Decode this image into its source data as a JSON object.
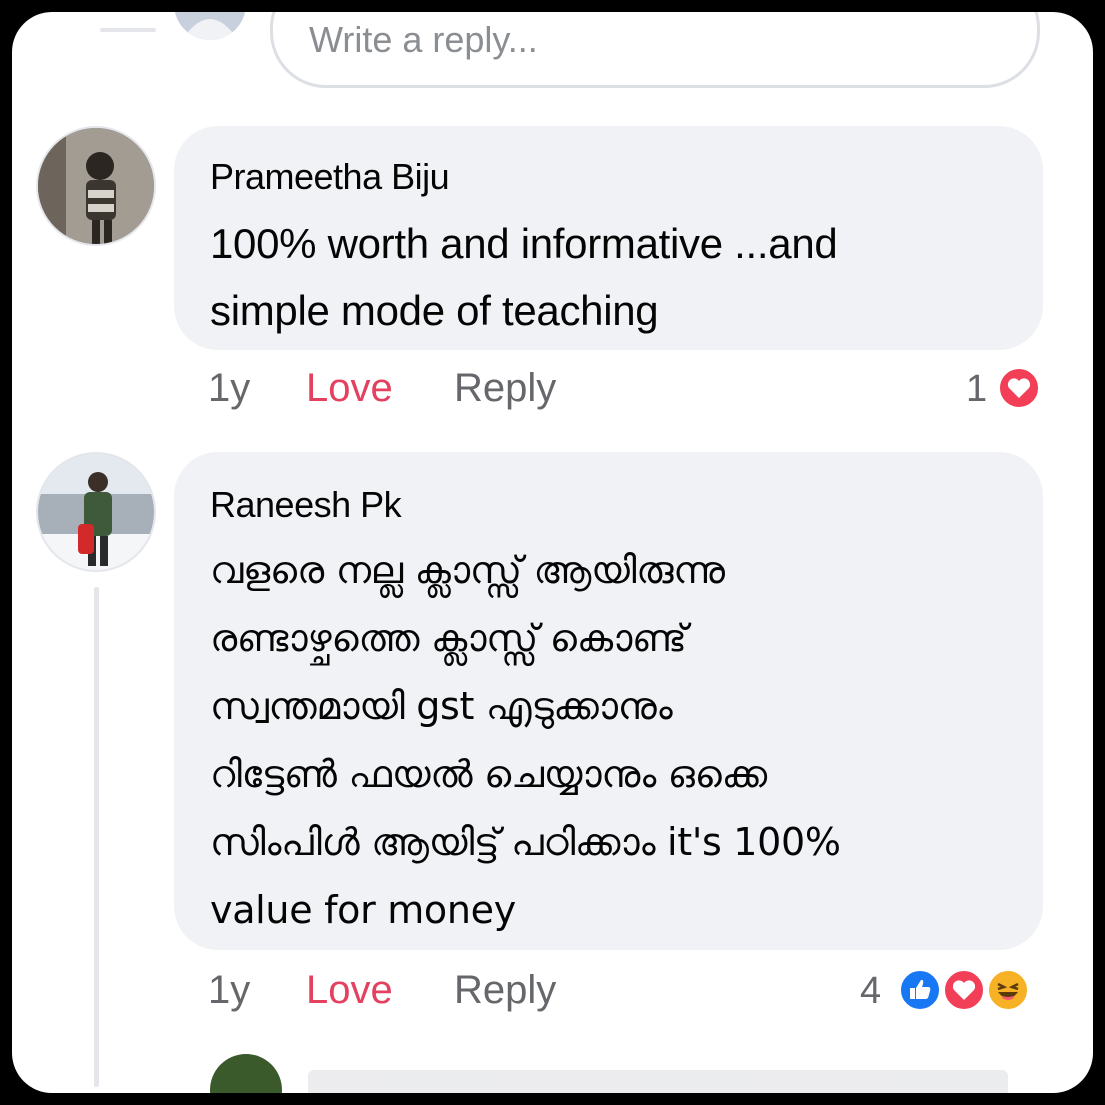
{
  "top_reply": {
    "placeholder": "Write a reply..."
  },
  "comments": [
    {
      "author": "Prameetha Biju",
      "text": "100% worth and  informative ...and\nsimple mode of teaching",
      "time": "1y",
      "love_label": "Love",
      "reply_label": "Reply",
      "reaction_count": "1",
      "reactions": [
        "love-icon"
      ]
    },
    {
      "author": "Raneesh Pk",
      "text": "വളരെ നല്ല ക്ലാസ്സ് ആയിരുന്നു\nരണ്ടാഴ്ചത്തെ ക്ലാസ്സ് കൊണ്ട്\nസ്വന്തമായി gst എടുക്കാനും\nറിട്ടേൺ ഫയൽ ചെയ്യാനും ഒക്കെ\nസിംപിൾ ആയിട്ട് പഠിക്കാം it's 100%\nvalue for money",
      "time": "1y",
      "love_label": "Love",
      "reply_label": "Reply",
      "reaction_count": "4",
      "reactions": [
        "like-icon",
        "love-icon",
        "haha-icon"
      ]
    }
  ],
  "colors": {
    "bubble": "#f0f2f5",
    "love": "#e4405f",
    "meta": "#65676b",
    "like_blue": "#1877f2",
    "love_red": "#f33e58",
    "haha_yellow": "#f7b125"
  }
}
